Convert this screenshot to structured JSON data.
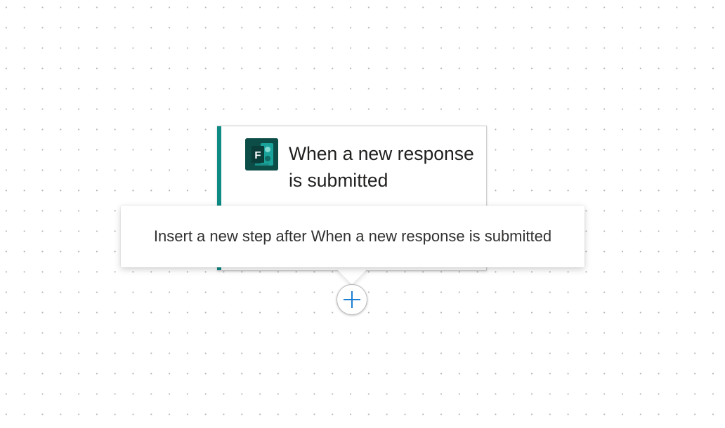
{
  "trigger_card": {
    "title": "When a new response is submitted",
    "icon": "microsoft-forms-icon",
    "icon_letter": "F",
    "accent_color": "#0e8a84",
    "icon_bg_color": "#0c4d48"
  },
  "tooltip": {
    "text": "Insert a new step after When a new response is submitted"
  },
  "insert_button": {
    "icon": "plus-icon",
    "icon_color": "#1a7fd4"
  }
}
